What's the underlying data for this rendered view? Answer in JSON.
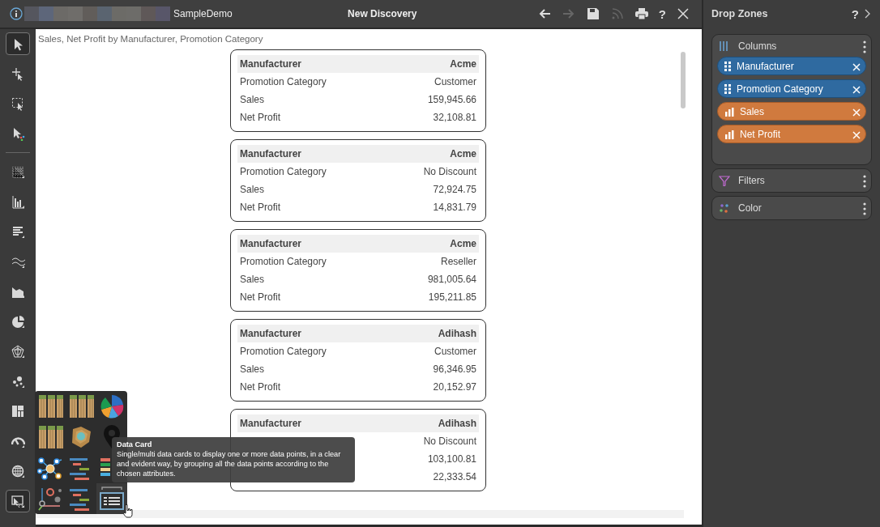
{
  "header": {
    "app_name": "SampleDemo",
    "title": "New Discovery",
    "actions": [
      {
        "kind": "back",
        "disabled": false
      },
      {
        "kind": "forward",
        "disabled": true
      },
      {
        "kind": "save",
        "disabled": false
      },
      {
        "kind": "feed",
        "disabled": true
      },
      {
        "kind": "print",
        "disabled": false
      },
      {
        "kind": "help",
        "label": "?",
        "disabled": false
      },
      {
        "kind": "close",
        "disabled": false
      }
    ]
  },
  "toolbar": {
    "tools": [
      {
        "kind": "pointer",
        "selected": true
      },
      {
        "kind": "add-point",
        "selected": false
      },
      {
        "kind": "marquee",
        "selected": false
      },
      {
        "kind": "color-pointer",
        "selected": false
      },
      {
        "kind": "divider"
      },
      {
        "kind": "grid",
        "selected": false
      },
      {
        "kind": "columns",
        "selected": false
      },
      {
        "kind": "bars",
        "selected": false
      },
      {
        "kind": "lines",
        "selected": false
      },
      {
        "kind": "area",
        "selected": false
      },
      {
        "kind": "pie",
        "selected": false
      },
      {
        "kind": "radar",
        "selected": false
      },
      {
        "kind": "scatter",
        "selected": false
      },
      {
        "kind": "treemap",
        "selected": false
      },
      {
        "kind": "gauge",
        "selected": false
      },
      {
        "kind": "globe",
        "selected": false
      },
      {
        "kind": "custom",
        "selected": true
      }
    ]
  },
  "chart": {
    "title": "Sales, Net Profit by Manufacturer, Promotion Category",
    "cards": [
      {
        "rows": [
          {
            "label": "Manufacturer",
            "value": "Acme"
          },
          {
            "label": "Promotion Category",
            "value": "Customer"
          },
          {
            "label": "Sales",
            "value": "159,945.66"
          },
          {
            "label": "Net Profit",
            "value": "32,108.81"
          }
        ]
      },
      {
        "rows": [
          {
            "label": "Manufacturer",
            "value": "Acme"
          },
          {
            "label": "Promotion Category",
            "value": "No Discount"
          },
          {
            "label": "Sales",
            "value": "72,924.75"
          },
          {
            "label": "Net Profit",
            "value": "14,831.79"
          }
        ]
      },
      {
        "rows": [
          {
            "label": "Manufacturer",
            "value": "Acme"
          },
          {
            "label": "Promotion Category",
            "value": "Reseller"
          },
          {
            "label": "Sales",
            "value": "981,005.64"
          },
          {
            "label": "Net Profit",
            "value": "195,211.85"
          }
        ]
      },
      {
        "rows": [
          {
            "label": "Manufacturer",
            "value": "Adihash"
          },
          {
            "label": "Promotion Category",
            "value": "Customer"
          },
          {
            "label": "Sales",
            "value": "96,346.95"
          },
          {
            "label": "Net Profit",
            "value": "20,152.97"
          }
        ]
      },
      {
        "rows": [
          {
            "label": "Manufacturer",
            "value": "Adihash"
          },
          {
            "value": "No Discount"
          },
          {
            "value": "103,100.81"
          },
          {
            "value": "22,333.54"
          }
        ]
      }
    ]
  },
  "chart_picker": {
    "options": [
      {
        "kind": "bars-grid",
        "selected": false
      },
      {
        "kind": "bars-grid",
        "selected": false
      },
      {
        "kind": "sunburst",
        "selected": false
      },
      {
        "kind": "bars-grid",
        "selected": false
      },
      {
        "kind": "contour",
        "selected": false
      },
      {
        "kind": "map-pin",
        "selected": false
      },
      {
        "kind": "network",
        "selected": false
      },
      {
        "kind": "gantt",
        "selected": false
      },
      {
        "kind": "stacked-bars",
        "selected": false
      },
      {
        "kind": "scatter",
        "selected": false
      },
      {
        "kind": "gantt",
        "selected": false
      },
      {
        "kind": "data-card",
        "selected": true
      }
    ],
    "tooltip": {
      "title": "Data Card",
      "description": "Single/multi data cards to display one or more data points, in a clear and evident way, by grouping all the data points according to the chosen attributes."
    }
  },
  "drop_zones": {
    "title": "Drop Zones",
    "help": "?",
    "zones": [
      {
        "kind": "columns",
        "label": "Columns",
        "fields": [
          {
            "label": "Manufacturer",
            "kind": "dimension"
          },
          {
            "label": "Promotion Category",
            "kind": "dimension"
          },
          {
            "label": "Sales",
            "kind": "measure"
          },
          {
            "label": "Net Profit",
            "kind": "measure"
          }
        ]
      },
      {
        "kind": "filters",
        "label": "Filters"
      },
      {
        "kind": "color",
        "label": "Color"
      }
    ]
  }
}
